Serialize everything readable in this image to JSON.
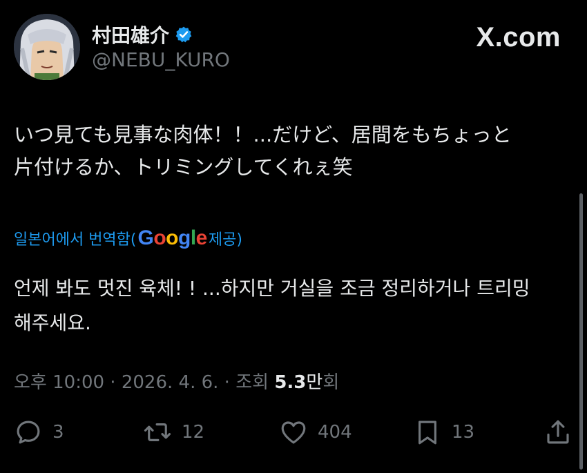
{
  "author": {
    "display_name": "村田雄介",
    "handle": "@NEBU_KURO",
    "verified_icon": "verified-badge-icon"
  },
  "brand": "X.com",
  "tweet": {
    "line1": "いつ見ても見事な肉体！！...だけど、居間をもちょっと",
    "line2": "片付けるか、トリミングしてくれぇ笑"
  },
  "translation": {
    "prefix": "일본어에서 번역함(",
    "google": [
      "G",
      "o",
      "o",
      "g",
      "l",
      "e"
    ],
    "suffix": " 제공)",
    "line1": "언제 봐도 멋진 육체! ! ...하지만 거실을 조금 정리하거나 트리밍",
    "line2": "해주세요."
  },
  "meta": {
    "time": "오후 10:00",
    "sep1": " · ",
    "date": "2026. 4. 6.",
    "sep2": " · ",
    "views_label": "조회 ",
    "views_num": "5.3",
    "views_unit": "만",
    "views_suffix": "회"
  },
  "actions": {
    "replies": "3",
    "reposts": "12",
    "likes": "404",
    "bookmarks": "13"
  },
  "colors": {
    "background": "#000000",
    "text": "#e7e9ea",
    "muted": "#71767b",
    "link": "#1d9bf0"
  }
}
